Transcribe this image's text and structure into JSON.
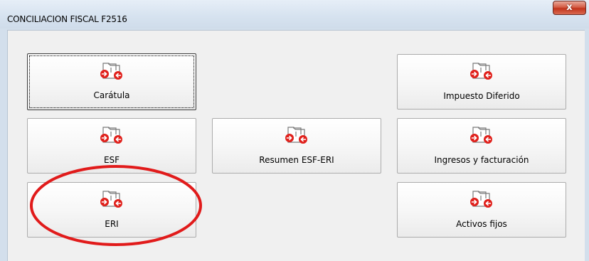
{
  "window": {
    "title": "CONCILIACION FISCAL F2516",
    "close_label": "x"
  },
  "buttons": {
    "caratula": "Carátula",
    "impuesto_diferido": "Impuesto Diferido",
    "esf": "ESF",
    "resumen": "Resumen ESF-ERI",
    "ingresos": "Ingresos y facturación",
    "eri": "ERI",
    "activos": "Activos fijos"
  },
  "icons": {
    "tile_icon": "exchange-folder-arrows-icon"
  },
  "colors": {
    "icon_red": "#e0201b",
    "annotation_red": "#e11b1b",
    "frame_blue": "#d3dfec"
  }
}
